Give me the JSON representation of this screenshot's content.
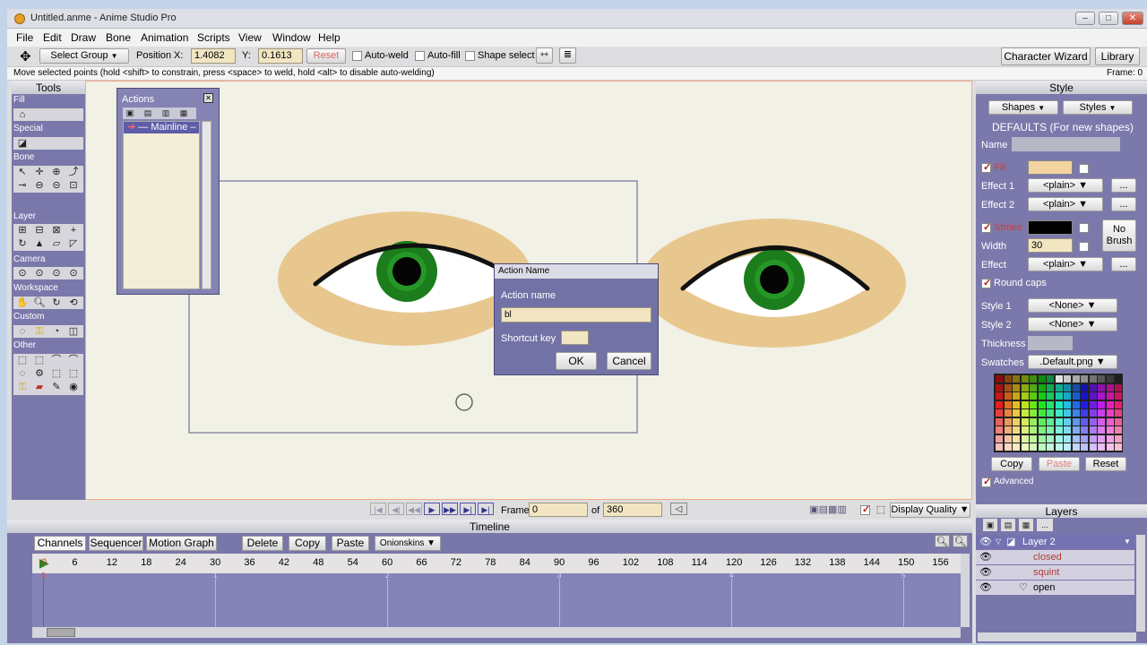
{
  "window": {
    "title": "Untitled.anme - Anime Studio Pro"
  },
  "menu": [
    "File",
    "Edit",
    "Draw",
    "Bone",
    "Animation",
    "Scripts",
    "View",
    "Window",
    "Help"
  ],
  "toolbar": {
    "select_group": "Select Group",
    "position_label": "Position",
    "x_label": "X:",
    "x_value": "1.4082",
    "y_label": "Y:",
    "y_value": "0.1613",
    "reset": "Reset",
    "auto_weld": "Auto-weld",
    "auto_fill": "Auto-fill",
    "shape_select": "Shape select",
    "character_wizard": "Character Wizard",
    "library": "Library"
  },
  "status": {
    "hint": "Move selected points (hold <shift> to constrain, press <space> to weld, hold <alt> to disable auto-welding)",
    "frame": "Frame: 0"
  },
  "tools": {
    "title": "Tools",
    "sections": [
      "Fill",
      "Special",
      "Bone",
      "Layer",
      "Camera",
      "Workspace",
      "Custom",
      "Other"
    ]
  },
  "actions_panel": {
    "title": "Actions",
    "item": "Mainline"
  },
  "dialog": {
    "title": "Action Name",
    "name_label": "Action name",
    "name_value": "bl",
    "shortcut_label": "Shortcut key",
    "ok": "OK",
    "cancel": "Cancel"
  },
  "style": {
    "title": "Style",
    "shapes": "Shapes",
    "styles": "Styles",
    "defaults": "DEFAULTS (For new shapes)",
    "name_label": "Name",
    "fill_label": "Fill",
    "effect1_label": "Effect 1",
    "effect1_value": "<plain>",
    "effect2_label": "Effect 2",
    "effect2_value": "<plain>",
    "stroke_label": "Stroke",
    "no_brush": "No Brush",
    "width_label": "Width",
    "width_value": "30",
    "effect_label": "Effect",
    "effect_value": "<plain>",
    "round_caps": "Round caps",
    "style1_label": "Style 1",
    "style1_value": "<None>",
    "style2_label": "Style 2",
    "style2_value": "<None>",
    "thickness_label": "Thickness",
    "swatches_label": "Swatches",
    "swatches_value": ".Default.png",
    "copy": "Copy",
    "paste": "Paste",
    "reset": "Reset",
    "advanced": "Advanced",
    "fill_color": "#f3d3a0",
    "stroke_color": "#000000",
    "ellipsis": "..."
  },
  "transport": {
    "frame_label": "Frame",
    "frame_value": "0",
    "of_label": "of",
    "total": "360",
    "display_quality": "Display Quality"
  },
  "timeline": {
    "title": "Timeline",
    "tabs": [
      "Channels",
      "Sequencer",
      "Motion Graph"
    ],
    "delete": "Delete",
    "copy": "Copy",
    "paste": "Paste",
    "onionskins": "Onionskins",
    "ticks": [
      "0",
      "6",
      "12",
      "18",
      "24",
      "30",
      "36",
      "42",
      "48",
      "54",
      "60",
      "66",
      "72",
      "78",
      "84",
      "90",
      "96",
      "102",
      "108",
      "114",
      "120",
      "126",
      "132",
      "138",
      "144",
      "150",
      "156"
    ],
    "markers": [
      "0",
      "1",
      "2",
      "3",
      "4",
      "5"
    ]
  },
  "layers": {
    "title": "Layers",
    "ellipsis": "...",
    "items": [
      {
        "name": "Layer 2"
      },
      {
        "name": "closed"
      },
      {
        "name": "squint"
      },
      {
        "name": "open"
      }
    ]
  },
  "colors": {
    "accent_red": "#d03c3c",
    "panel": "#7b79ab",
    "canvas": "#f1f1e6"
  }
}
